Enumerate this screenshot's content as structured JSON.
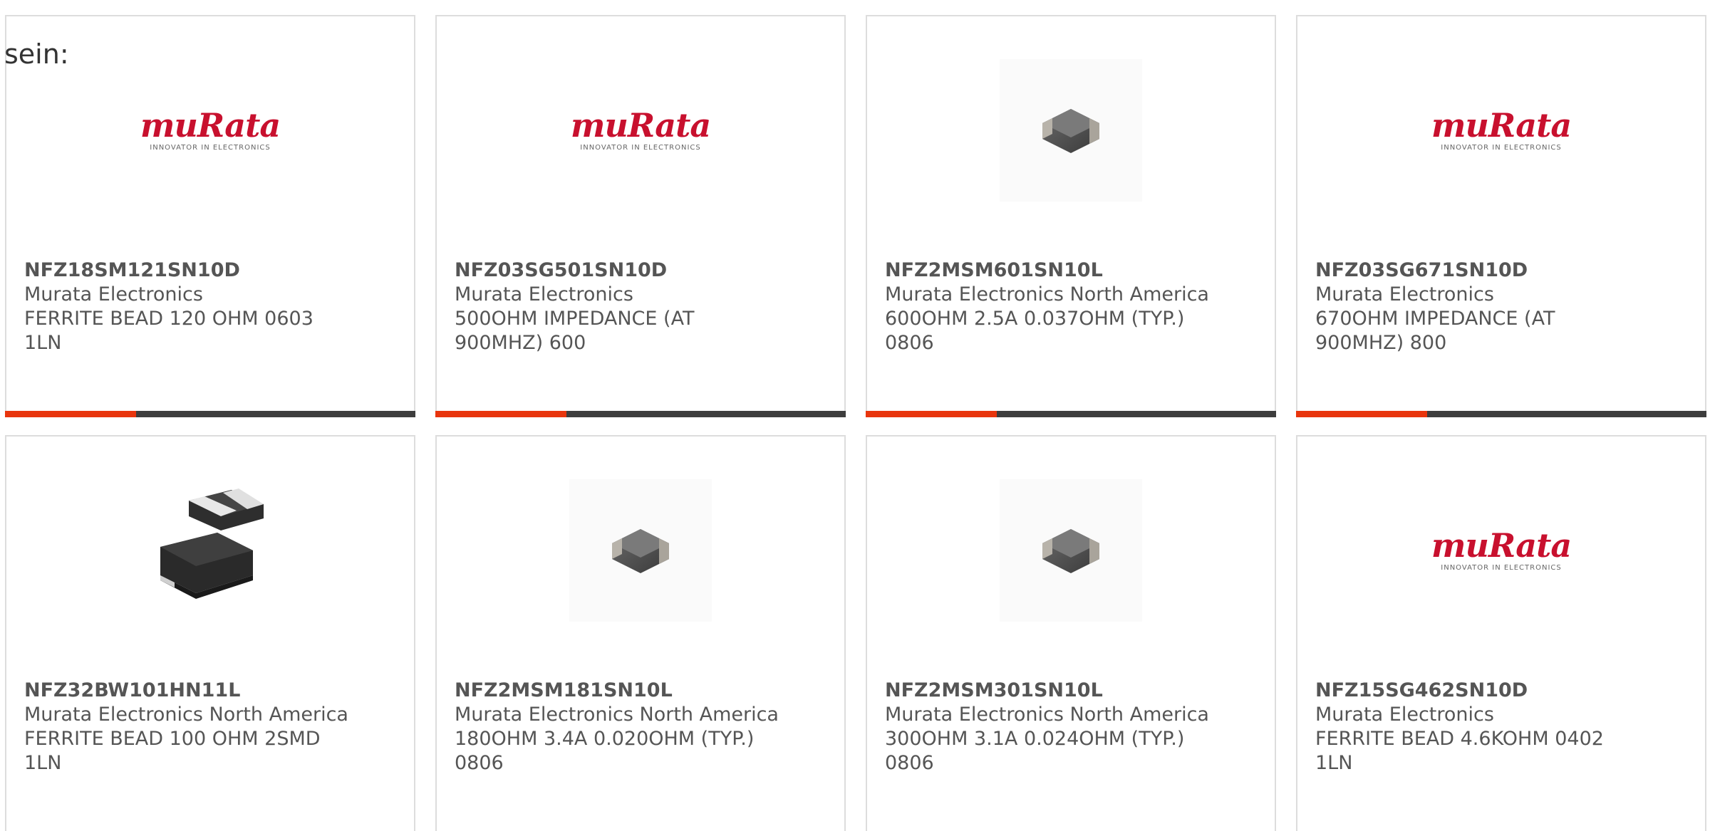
{
  "intro_text": "sein:",
  "colors": {
    "accent": "#e8350d",
    "bar": "#3d3d3d",
    "brand_red": "#c8102e",
    "text": "#555555"
  },
  "logo": {
    "word": "muRata",
    "tagline": "INNOVATOR IN ELECTRONICS"
  },
  "products": [
    {
      "part_number": "NFZ18SM121SN10D",
      "manufacturer": "Murata Electronics",
      "description_line1": "FERRITE BEAD 120 OHM 0603",
      "description_line2": "1LN",
      "image": "murata-logo"
    },
    {
      "part_number": "NFZ03SG501SN10D",
      "manufacturer": "Murata Electronics",
      "description_line1": "500OHM IMPEDANCE (AT",
      "description_line2": "900MHZ) 600",
      "image": "murata-logo"
    },
    {
      "part_number": "NFZ2MSM601SN10L",
      "manufacturer": "Murata Electronics North America",
      "description_line1": "600OHM 2.5A 0.037OHM (TYP.)",
      "description_line2": "0806",
      "image": "chip-bead-photo"
    },
    {
      "part_number": "NFZ03SG671SN10D",
      "manufacturer": "Murata Electronics",
      "description_line1": "670OHM IMPEDANCE (AT",
      "description_line2": "900MHZ) 800",
      "image": "murata-logo"
    },
    {
      "part_number": "NFZ32BW101HN11L",
      "manufacturer": "Murata Electronics North America",
      "description_line1": "FERRITE BEAD 100 OHM 2SMD",
      "description_line2": "1LN",
      "image": "smd-inductor-photo"
    },
    {
      "part_number": "NFZ2MSM181SN10L",
      "manufacturer": "Murata Electronics North America",
      "description_line1": "180OHM 3.4A 0.020OHM (TYP.)",
      "description_line2": "0806",
      "image": "chip-bead-photo"
    },
    {
      "part_number": "NFZ2MSM301SN10L",
      "manufacturer": "Murata Electronics North America",
      "description_line1": "300OHM 3.1A 0.024OHM (TYP.)",
      "description_line2": "0806",
      "image": "chip-bead-photo"
    },
    {
      "part_number": "NFZ15SG462SN10D",
      "manufacturer": "Murata Electronics",
      "description_line1": "FERRITE BEAD 4.6KOHM 0402",
      "description_line2": "1LN",
      "image": "murata-logo"
    }
  ]
}
